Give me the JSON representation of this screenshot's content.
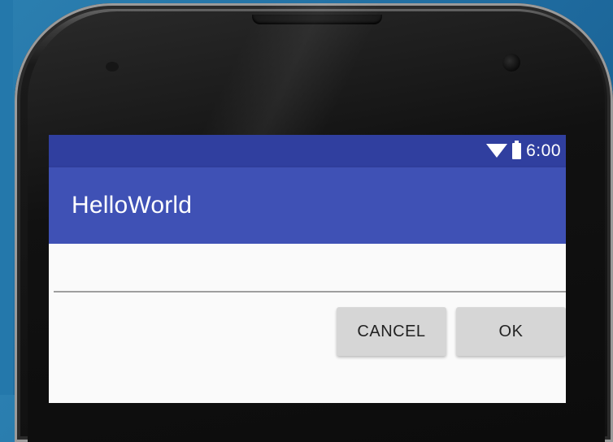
{
  "status_bar": {
    "time": "6:00",
    "icons": [
      "wifi-icon",
      "battery-icon"
    ]
  },
  "app_bar": {
    "title": "HelloWorld"
  },
  "content": {
    "input_value": "",
    "cancel_label": "CANCEL",
    "ok_label": "OK"
  },
  "colors": {
    "status_bar": "#303f9f",
    "app_bar": "#3f51b5",
    "background": "#2b7fb0",
    "button": "#d6d6d6"
  }
}
